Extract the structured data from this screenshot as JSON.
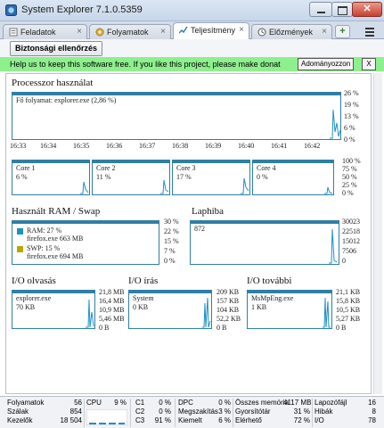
{
  "window": {
    "title": "System Explorer 7.1.0.5359",
    "close_glyph": "✕"
  },
  "tabs": [
    {
      "label": "Feladatok",
      "icon": "tasks-icon"
    },
    {
      "label": "Folyamatok",
      "icon": "processes-icon"
    },
    {
      "label": "Teljesítmény",
      "icon": "performance-icon"
    },
    {
      "label": "Előzmények",
      "icon": "history-icon"
    }
  ],
  "tab_close_glyph": "×",
  "tab_add_glyph": "+",
  "toolbar": {
    "security_label": "Biztonsági ellenőrzés"
  },
  "banner": {
    "text": "Help us to keep this software free.  If you like this project, please make donat",
    "donate_label": "Adományozzon",
    "close_label": "X"
  },
  "processor": {
    "title": "Processzor használat",
    "main_label": "Fő folyamat: explorer.exe (2,86 %)",
    "y_ticks": [
      "26 %",
      "19 %",
      "13 %",
      "6 %",
      "0 %"
    ],
    "x_ticks": [
      "16:33",
      "16:34",
      "16:35",
      "16:36",
      "16:37",
      "16:38",
      "16:39",
      "16:40",
      "16:41",
      "16:42"
    ],
    "cores": [
      {
        "name": "Core 1",
        "value": "6 %"
      },
      {
        "name": "Core 2",
        "value": "11 %"
      },
      {
        "name": "Core 3",
        "value": "17 %"
      },
      {
        "name": "Core 4",
        "value": "0 %"
      }
    ],
    "core_ticks": [
      "100 %",
      "75 %",
      "50 %",
      "25 %",
      "0 %"
    ]
  },
  "ram": {
    "title": "Használt RAM / Swap",
    "ram_label": "RAM: 27 %",
    "ram_proc": "firefox.exe 663 MB",
    "swp_label": "SWP: 15 %",
    "swp_proc": "firefox.exe 694 MB",
    "ticks": [
      "30 %",
      "22 %",
      "15 %",
      "7 %",
      "0 %"
    ],
    "ram_color": "#1f8fc9",
    "swp_color": "#b9a800"
  },
  "pagefault": {
    "title": "Laphiba",
    "value": "872",
    "ticks": [
      "30023",
      "22518",
      "15012",
      "7506",
      "0"
    ]
  },
  "io_read": {
    "title": "I/O olvasás",
    "proc": "explorer.exe",
    "value": "70 KB",
    "ticks": [
      "21,8 MB",
      "16,4 MB",
      "10,9 MB",
      "5,46 MB",
      "0 B"
    ]
  },
  "io_write": {
    "title": "I/O írás",
    "proc": "System",
    "value": "0 KB",
    "ticks": [
      "209 KB",
      "157 KB",
      "104 KB",
      "52,2 KB",
      "0 B"
    ]
  },
  "io_other": {
    "title": "I/O további",
    "proc": "MsMpEng.exe",
    "value": "1 KB",
    "ticks": [
      "21,1 KB",
      "15,8 KB",
      "10,5 KB",
      "5,27 KB",
      "0 B"
    ]
  },
  "status": {
    "folyamatok": {
      "label": "Folyamatok",
      "value": "56"
    },
    "szalak": {
      "label": "Szálak",
      "value": "854"
    },
    "kezelok": {
      "label": "Kezelők",
      "value": "18 504"
    },
    "cpu": {
      "label": "CPU",
      "value": "9 %"
    },
    "c1": {
      "label": "C1",
      "value": "0 %"
    },
    "c2": {
      "label": "C2",
      "value": "0 %"
    },
    "c3": {
      "label": "C3",
      "value": "91 %"
    },
    "dpc": {
      "label": "DPC",
      "value": "0 %"
    },
    "megszakitas": {
      "label": "Megszakítás",
      "value": "3 %"
    },
    "kiemelt": {
      "label": "Kiemelt",
      "value": "6 %"
    },
    "osszes_memoria": {
      "label": "Összes memória",
      "value": "4117 MB"
    },
    "gyorsitotar": {
      "label": "Gyorsítótár",
      "value": "31 %"
    },
    "elerheto": {
      "label": "Elérhető",
      "value": "72 %"
    },
    "laphiba": {
      "label": "Lapozófájl",
      "value": "16"
    },
    "hibak": {
      "label": "Hibák",
      "value": "8"
    },
    "io": {
      "label": "I/O",
      "value": "78"
    }
  },
  "colors": {
    "graph_border": "#2f7fa4",
    "graph_line": "#1f8fc9",
    "banner": "#8df08d"
  }
}
